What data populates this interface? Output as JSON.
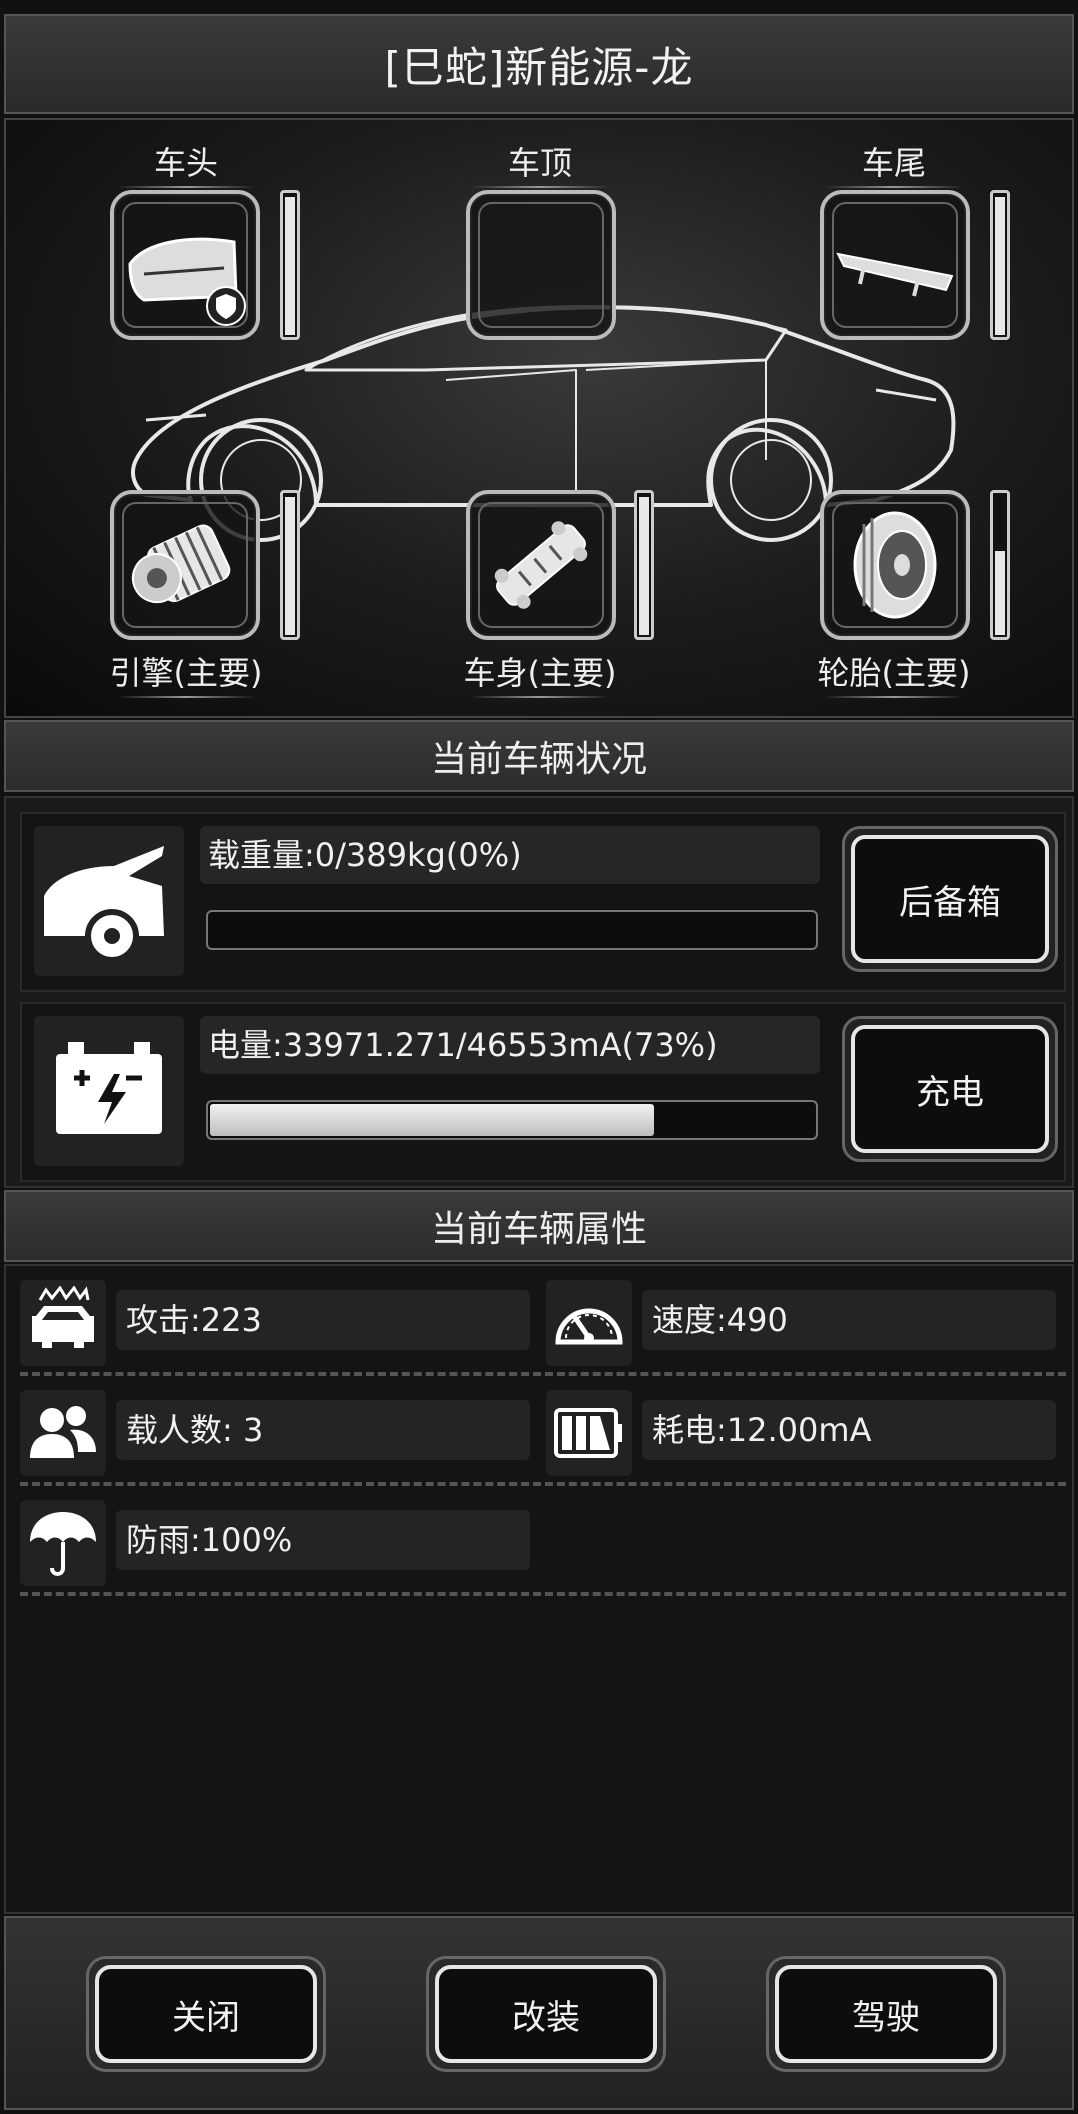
{
  "title": "[巳蛇]新能源-龙",
  "slots": {
    "head": {
      "label": "车头",
      "gauge": 1.0
    },
    "roof": {
      "label": "车顶"
    },
    "tail": {
      "label": "车尾",
      "gauge": 1.0
    },
    "engine": {
      "label": "引擎(主要)",
      "gauge": 1.0
    },
    "body": {
      "label": "车身(主要)",
      "gauge": 1.0
    },
    "tire": {
      "label": "轮胎(主要)",
      "gauge": 0.6
    }
  },
  "status_header": "当前车辆状况",
  "status": {
    "load": {
      "text": "载重量:0/389kg(0%)",
      "progress": 0.0,
      "button": "后备箱"
    },
    "power": {
      "text": "电量:33971.271/46553mA(73%)",
      "progress": 0.73,
      "button": "充电"
    }
  },
  "attr_header": "当前车辆属性",
  "attributes": {
    "attack": "攻击:223",
    "speed": "速度:490",
    "passengers": "载人数: 3",
    "consumption": "耗电:12.00mA",
    "rainproof": "防雨:100%"
  },
  "buttons": {
    "close": "关闭",
    "modify": "改装",
    "drive": "驾驶"
  },
  "icons": [
    "car-icon",
    "trunk-car-icon",
    "battery-icon",
    "crash-car-icon",
    "speedometer-icon",
    "people-icon",
    "battery-level-icon",
    "umbrella-icon",
    "bumper-icon",
    "spoiler-icon",
    "engine-icon",
    "chassis-icon",
    "tire-icon",
    "shield-icon"
  ]
}
